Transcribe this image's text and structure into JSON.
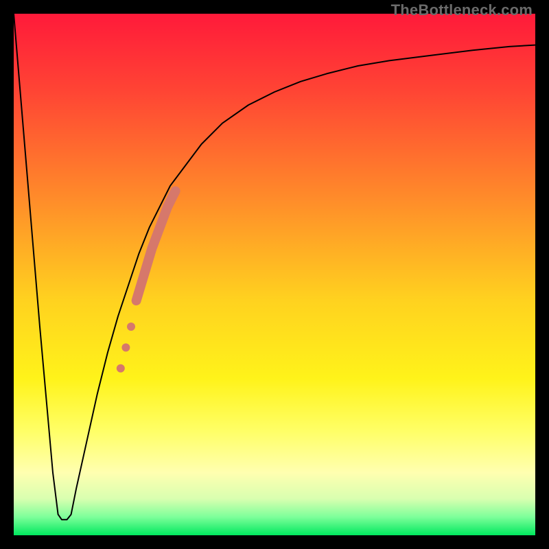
{
  "watermark": "TheBottleneck.com",
  "chart_data": {
    "type": "line",
    "title": "",
    "xlabel": "",
    "ylabel": "",
    "xlim": [
      0,
      100
    ],
    "ylim": [
      0,
      100
    ],
    "grid": false,
    "legend": false,
    "gradient_stops": [
      {
        "offset": 0.0,
        "color": "#ff1a3a"
      },
      {
        "offset": 0.15,
        "color": "#ff4534"
      },
      {
        "offset": 0.35,
        "color": "#ff8a2a"
      },
      {
        "offset": 0.55,
        "color": "#ffd21f"
      },
      {
        "offset": 0.7,
        "color": "#fff31a"
      },
      {
        "offset": 0.8,
        "color": "#ffff66"
      },
      {
        "offset": 0.88,
        "color": "#ffffb0"
      },
      {
        "offset": 0.93,
        "color": "#d9ffb0"
      },
      {
        "offset": 0.965,
        "color": "#7dff9a"
      },
      {
        "offset": 1.0,
        "color": "#00e85e"
      }
    ],
    "series": [
      {
        "name": "bottleneck-curve",
        "color": "#000000",
        "width": 2,
        "x": [
          0,
          2.5,
          5,
          7.5,
          8.5,
          9.2,
          10.2,
          11,
          12,
          14,
          16,
          18,
          20,
          22,
          24,
          26,
          28,
          30,
          33,
          36,
          40,
          45,
          50,
          55,
          60,
          66,
          72,
          80,
          88,
          95,
          100
        ],
        "y": [
          100,
          70,
          40,
          12,
          4,
          3,
          3,
          4,
          9,
          18,
          27,
          35,
          42,
          48,
          54,
          59,
          63,
          67,
          71,
          75,
          79,
          82.5,
          85,
          87,
          88.5,
          90,
          91,
          92,
          93,
          93.7,
          94
        ]
      }
    ],
    "markers": [
      {
        "name": "dots",
        "color": "#d6786b",
        "radius": 6,
        "x": [
          20.5,
          21.5,
          22.5
        ],
        "y": [
          32,
          36,
          40
        ]
      },
      {
        "name": "thick-segment",
        "color": "#d6786b",
        "width": 14,
        "x": [
          23.5,
          25,
          26.5,
          28,
          29.5,
          31
        ],
        "y": [
          45,
          50,
          55,
          59,
          63,
          66
        ]
      }
    ]
  }
}
